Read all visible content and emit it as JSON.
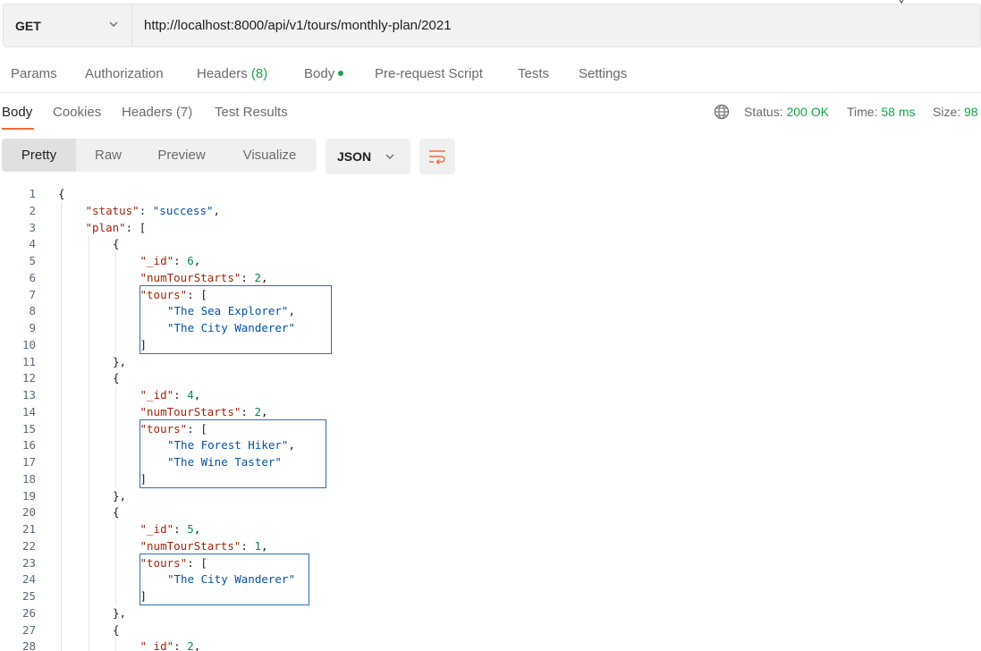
{
  "request": {
    "method": "GET",
    "url": "http://localhost:8000/api/v1/tours/monthly-plan/2021"
  },
  "request_tabs": [
    {
      "label": "Params"
    },
    {
      "label": "Authorization"
    },
    {
      "label": "Headers",
      "count": "(8)"
    },
    {
      "label": "Body"
    },
    {
      "label": "Pre-request Script"
    },
    {
      "label": "Tests"
    },
    {
      "label": "Settings"
    }
  ],
  "response_tabs": [
    {
      "label": "Body"
    },
    {
      "label": "Cookies"
    },
    {
      "label": "Headers",
      "count": "(7)"
    },
    {
      "label": "Test Results"
    }
  ],
  "status": {
    "status_label": "Status:",
    "status_value": "200 OK",
    "time_label": "Time:",
    "time_value": "58 ms",
    "size_label": "Size:",
    "size_value": "98"
  },
  "view_modes": [
    "Pretty",
    "Raw",
    "Preview",
    "Visualize"
  ],
  "format": "JSON",
  "colors": {
    "accent": "#f26b3a",
    "success": "#16a34a",
    "key": "#a1260d",
    "string": "#0451a5",
    "number": "#098658",
    "highlight": "#2b6fc0"
  },
  "icons": {
    "method_chevron": "chevron-down-icon",
    "format_chevron": "chevron-down-icon",
    "wrap": "wrap-lines-icon",
    "globe": "globe-icon"
  },
  "code_lines": [
    {
      "n": "1",
      "indent": 0,
      "parts": [
        [
          "p",
          "{"
        ]
      ]
    },
    {
      "n": "2",
      "indent": 1,
      "parts": [
        [
          "k",
          "\"status\""
        ],
        [
          "p",
          ": "
        ],
        [
          "s",
          "\"success\""
        ],
        [
          "p",
          ","
        ]
      ]
    },
    {
      "n": "3",
      "indent": 1,
      "parts": [
        [
          "k",
          "\"plan\""
        ],
        [
          "p",
          ": ["
        ]
      ]
    },
    {
      "n": "4",
      "indent": 2,
      "parts": [
        [
          "p",
          "{"
        ]
      ]
    },
    {
      "n": "5",
      "indent": 3,
      "parts": [
        [
          "k",
          "\"_id\""
        ],
        [
          "p",
          ": "
        ],
        [
          "n",
          "6"
        ],
        [
          "p",
          ","
        ]
      ]
    },
    {
      "n": "6",
      "indent": 3,
      "parts": [
        [
          "k",
          "\"numTourStarts\""
        ],
        [
          "p",
          ": "
        ],
        [
          "n",
          "2"
        ],
        [
          "p",
          ","
        ]
      ]
    },
    {
      "n": "7",
      "indent": 3,
      "parts": [
        [
          "k",
          "\"tours\""
        ],
        [
          "p",
          ": ["
        ]
      ]
    },
    {
      "n": "8",
      "indent": 4,
      "parts": [
        [
          "s",
          "\"The Sea Explorer\""
        ],
        [
          "p",
          ","
        ]
      ]
    },
    {
      "n": "9",
      "indent": 4,
      "parts": [
        [
          "s",
          "\"The City Wanderer\""
        ]
      ]
    },
    {
      "n": "10",
      "indent": 3,
      "parts": [
        [
          "p",
          "]"
        ]
      ]
    },
    {
      "n": "11",
      "indent": 2,
      "parts": [
        [
          "p",
          "},"
        ]
      ]
    },
    {
      "n": "12",
      "indent": 2,
      "parts": [
        [
          "p",
          "{"
        ]
      ]
    },
    {
      "n": "13",
      "indent": 3,
      "parts": [
        [
          "k",
          "\"_id\""
        ],
        [
          "p",
          ": "
        ],
        [
          "n",
          "4"
        ],
        [
          "p",
          ","
        ]
      ]
    },
    {
      "n": "14",
      "indent": 3,
      "parts": [
        [
          "k",
          "\"numTourStarts\""
        ],
        [
          "p",
          ": "
        ],
        [
          "n",
          "2"
        ],
        [
          "p",
          ","
        ]
      ]
    },
    {
      "n": "15",
      "indent": 3,
      "parts": [
        [
          "k",
          "\"tours\""
        ],
        [
          "p",
          ": ["
        ]
      ]
    },
    {
      "n": "16",
      "indent": 4,
      "parts": [
        [
          "s",
          "\"The Forest Hiker\""
        ],
        [
          "p",
          ","
        ]
      ]
    },
    {
      "n": "17",
      "indent": 4,
      "parts": [
        [
          "s",
          "\"The Wine Taster\""
        ]
      ]
    },
    {
      "n": "18",
      "indent": 3,
      "parts": [
        [
          "p",
          "]"
        ]
      ]
    },
    {
      "n": "19",
      "indent": 2,
      "parts": [
        [
          "p",
          "},"
        ]
      ]
    },
    {
      "n": "20",
      "indent": 2,
      "parts": [
        [
          "p",
          "{"
        ]
      ]
    },
    {
      "n": "21",
      "indent": 3,
      "parts": [
        [
          "k",
          "\"_id\""
        ],
        [
          "p",
          ": "
        ],
        [
          "n",
          "5"
        ],
        [
          "p",
          ","
        ]
      ]
    },
    {
      "n": "22",
      "indent": 3,
      "parts": [
        [
          "k",
          "\"numTourStarts\""
        ],
        [
          "p",
          ": "
        ],
        [
          "n",
          "1"
        ],
        [
          "p",
          ","
        ]
      ]
    },
    {
      "n": "23",
      "indent": 3,
      "parts": [
        [
          "k",
          "\"tours\""
        ],
        [
          "p",
          ": ["
        ]
      ]
    },
    {
      "n": "24",
      "indent": 4,
      "parts": [
        [
          "s",
          "\"The City Wanderer\""
        ]
      ]
    },
    {
      "n": "25",
      "indent": 3,
      "parts": [
        [
          "p",
          "]"
        ]
      ]
    },
    {
      "n": "26",
      "indent": 2,
      "parts": [
        [
          "p",
          "},"
        ]
      ]
    },
    {
      "n": "27",
      "indent": 2,
      "parts": [
        [
          "p",
          "{"
        ]
      ]
    },
    {
      "n": "28",
      "indent": 3,
      "parts": [
        [
          "k",
          "\"_id\""
        ],
        [
          "p",
          ": "
        ],
        [
          "n",
          "2"
        ],
        [
          "p",
          ","
        ]
      ]
    }
  ],
  "highlight_ranges": [
    [
      7,
      10
    ],
    [
      15,
      18
    ],
    [
      23,
      25
    ]
  ]
}
